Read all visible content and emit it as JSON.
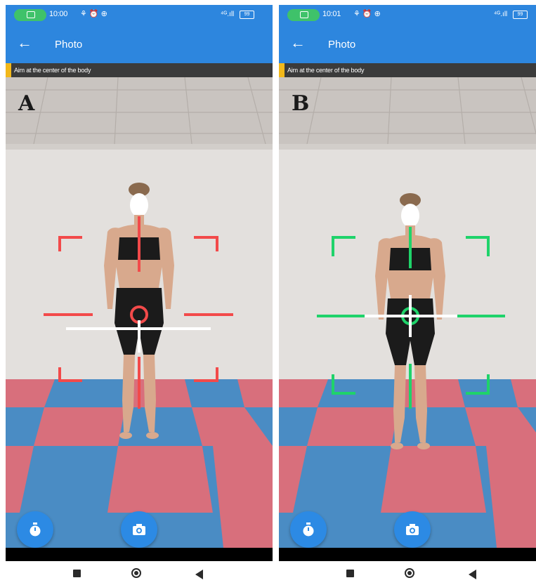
{
  "panels": [
    {
      "letter": "A",
      "status_time": "10:00",
      "status_icons": "⚘ ⏰ ⊕",
      "signal": "⁴ᴳ.ıll",
      "battery": "99",
      "title": "Photo",
      "hint": "Aim at the center of the body",
      "guide_color": "#f24a4a",
      "state": "misaligned"
    },
    {
      "letter": "B",
      "status_time": "10:01",
      "status_icons": "⚘ ⏰ ⊕",
      "signal": "⁴ᴳ.ıll",
      "battery": "99",
      "title": "Photo",
      "hint": "Aim at the center of the body",
      "guide_color": "#1fd36a",
      "state": "aligned"
    }
  ],
  "icons": {
    "back": "back-arrow-icon",
    "timer": "timer-icon",
    "camera": "camera-icon",
    "nav_recent": "recent-apps-icon",
    "nav_home": "home-icon",
    "nav_back": "nav-back-icon"
  },
  "colors": {
    "app_bar": "#2d86de",
    "fab": "#2c8ae4",
    "hint_accent": "#f2b81a",
    "status_pill": "#3fc26a"
  }
}
